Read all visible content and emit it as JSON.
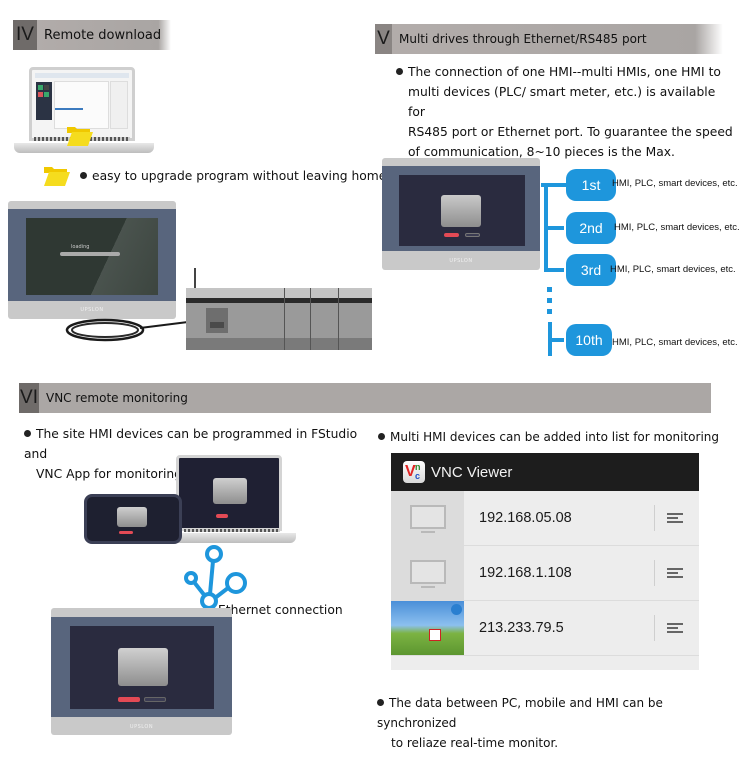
{
  "sections": {
    "iv": {
      "number": "IV",
      "title": "Remote download",
      "bullet": "easy to upgrade program without leaving home",
      "hmi_screen_text": "loading",
      "hmi_brand": "UPSLON"
    },
    "v": {
      "number": "V",
      "title": "Multi drives through Ethernet/RS485 port",
      "bullet_lines": [
        "The connection of one HMI--multi HMIs, one HMI to",
        "multi devices (PLC/ smart meter, etc.) is available for",
        "RS485 port or Ethernet port. To guarantee the speed",
        "of communication, 8~10 pieces is the Max."
      ],
      "hmi_brand": "UPSLON",
      "devices": [
        {
          "tag": "1st",
          "label": "HMI, PLC, smart devices, etc."
        },
        {
          "tag": "2nd",
          "label": "HMI, PLC, smart devices, etc."
        },
        {
          "tag": "3rd",
          "label": "HMI, PLC, smart devices, etc."
        },
        {
          "tag": "10th",
          "label": "HMI, PLC, smart devices, etc."
        }
      ]
    },
    "vi": {
      "number": "VI",
      "title": "VNC remote monitoring",
      "left_bullet_lines": [
        "The site HMI devices can be programmed in FStudio and",
        "VNC App for monitoring."
      ],
      "ethernet_label": "Ethernet connection",
      "hmi_brand": "UPSLON",
      "right_bullet": "Multi HMI devices can be added into list for monitoring",
      "bottom_bullet_lines": [
        "The data between PC, mobile and HMI can be synchronized",
        "to reliaze real-time monitor."
      ]
    }
  },
  "vnc_viewer": {
    "title": "VNC Viewer",
    "logo_text": "VNC",
    "connections": [
      {
        "ip": "192.168.05.08",
        "thumb": "monitor-icon"
      },
      {
        "ip": "192.168.1.108",
        "thumb": "monitor-icon"
      },
      {
        "ip": "213.233.79.5",
        "thumb": "desktop-screenshot"
      }
    ]
  },
  "colors": {
    "accent_blue": "#1e96dc",
    "header_gray": "#aba7a5",
    "folder_yellow": "#f5dc1e",
    "hmi_bezel": "#58657d"
  }
}
